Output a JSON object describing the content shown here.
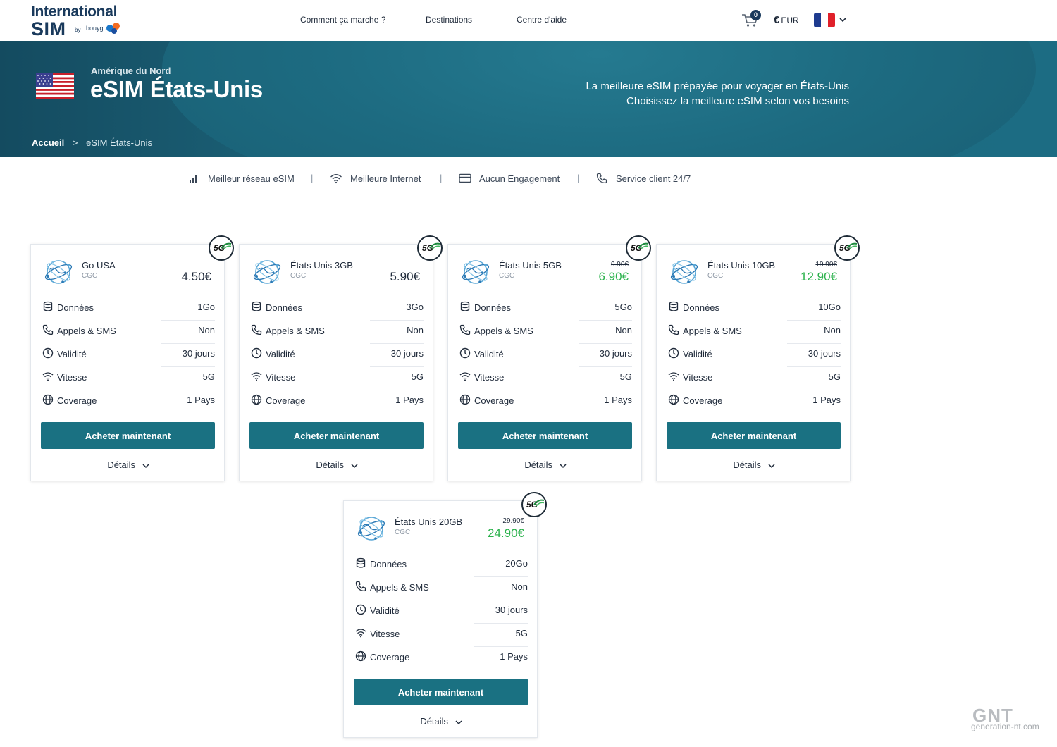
{
  "header": {
    "logo": {
      "line1": "International",
      "line2": "SIM",
      "by": "by",
      "brand": "bouygues"
    },
    "nav": [
      "Comment ça marche ?",
      "Destinations",
      "Centre d'aide"
    ],
    "cart_count": "0",
    "currency_symbol": "€",
    "currency": "EUR",
    "language_flag": "france-flag",
    "colors": {
      "brand_dark": "#1a3a5c",
      "button": "#1a7182",
      "promo": "#2bb24c",
      "hero": "#1e6277"
    }
  },
  "hero": {
    "region": "Amérique du Nord",
    "title": "eSIM États-Unis",
    "tagline_line1": "La meilleure eSIM prépayée pour voyager en États-Unis",
    "tagline_line2": "Choisissez la meilleure eSIM selon vos besoins",
    "breadcrumb": {
      "home": "Accueil",
      "separator": ">",
      "current": "eSIM États-Unis"
    }
  },
  "features": [
    {
      "icon": "signal-bars-icon",
      "label": "Meilleur réseau eSIM"
    },
    {
      "icon": "wifi-icon",
      "label": "Meilleure Internet"
    },
    {
      "icon": "card-icon",
      "label": "Aucun Engagement"
    },
    {
      "icon": "phone-icon",
      "label": "Service client 24/7"
    }
  ],
  "feature_divider": "|",
  "plans": [
    {
      "name": "Go USA",
      "sub": "CGC",
      "old_price": "",
      "price": "4.50€",
      "promo": false,
      "badge": "5G",
      "rows": [
        {
          "icon": "database-icon",
          "label": "Données",
          "value": "1Go"
        },
        {
          "icon": "phone-icon",
          "label": "Appels & SMS",
          "value": "Non"
        },
        {
          "icon": "clock-icon",
          "label": "Validité",
          "value": "30 jours"
        },
        {
          "icon": "wifi-icon",
          "label": "Vitesse",
          "value": "5G"
        },
        {
          "icon": "globe-icon",
          "label": "Coverage",
          "value": "1 Pays"
        }
      ],
      "buy_label": "Acheter maintenant",
      "details_label": "Détails"
    },
    {
      "name": "États Unis 3GB",
      "sub": "CGC",
      "old_price": "",
      "price": "5.90€",
      "promo": false,
      "badge": "5G",
      "rows": [
        {
          "icon": "database-icon",
          "label": "Données",
          "value": "3Go"
        },
        {
          "icon": "phone-icon",
          "label": "Appels & SMS",
          "value": "Non"
        },
        {
          "icon": "clock-icon",
          "label": "Validité",
          "value": "30 jours"
        },
        {
          "icon": "wifi-icon",
          "label": "Vitesse",
          "value": "5G"
        },
        {
          "icon": "globe-icon",
          "label": "Coverage",
          "value": "1 Pays"
        }
      ],
      "buy_label": "Acheter maintenant",
      "details_label": "Détails"
    },
    {
      "name": "États Unis 5GB",
      "sub": "CGC",
      "old_price": "9.90€",
      "price": "6.90€",
      "promo": true,
      "badge": "5G",
      "rows": [
        {
          "icon": "database-icon",
          "label": "Données",
          "value": "5Go"
        },
        {
          "icon": "phone-icon",
          "label": "Appels & SMS",
          "value": "Non"
        },
        {
          "icon": "clock-icon",
          "label": "Validité",
          "value": "30 jours"
        },
        {
          "icon": "wifi-icon",
          "label": "Vitesse",
          "value": "5G"
        },
        {
          "icon": "globe-icon",
          "label": "Coverage",
          "value": "1 Pays"
        }
      ],
      "buy_label": "Acheter maintenant",
      "details_label": "Détails"
    },
    {
      "name": "États Unis 10GB",
      "sub": "CGC",
      "old_price": "19.90€",
      "price": "12.90€",
      "promo": true,
      "badge": "5G",
      "rows": [
        {
          "icon": "database-icon",
          "label": "Données",
          "value": "10Go"
        },
        {
          "icon": "phone-icon",
          "label": "Appels & SMS",
          "value": "Non"
        },
        {
          "icon": "clock-icon",
          "label": "Validité",
          "value": "30 jours"
        },
        {
          "icon": "wifi-icon",
          "label": "Vitesse",
          "value": "5G"
        },
        {
          "icon": "globe-icon",
          "label": "Coverage",
          "value": "1 Pays"
        }
      ],
      "buy_label": "Acheter maintenant",
      "details_label": "Détails"
    },
    {
      "name": "États Unis 20GB",
      "sub": "CGC",
      "old_price": "29.90€",
      "price": "24.90€",
      "promo": true,
      "badge": "5G",
      "rows": [
        {
          "icon": "database-icon",
          "label": "Données",
          "value": "20Go"
        },
        {
          "icon": "phone-icon",
          "label": "Appels & SMS",
          "value": "Non"
        },
        {
          "icon": "clock-icon",
          "label": "Validité",
          "value": "30 jours"
        },
        {
          "icon": "wifi-icon",
          "label": "Vitesse",
          "value": "5G"
        },
        {
          "icon": "globe-icon",
          "label": "Coverage",
          "value": "1 Pays"
        }
      ],
      "buy_label": "Acheter maintenant",
      "details_label": "Détails"
    }
  ],
  "watermark": {
    "big": "GNT",
    "small": "generation-nt.com"
  }
}
